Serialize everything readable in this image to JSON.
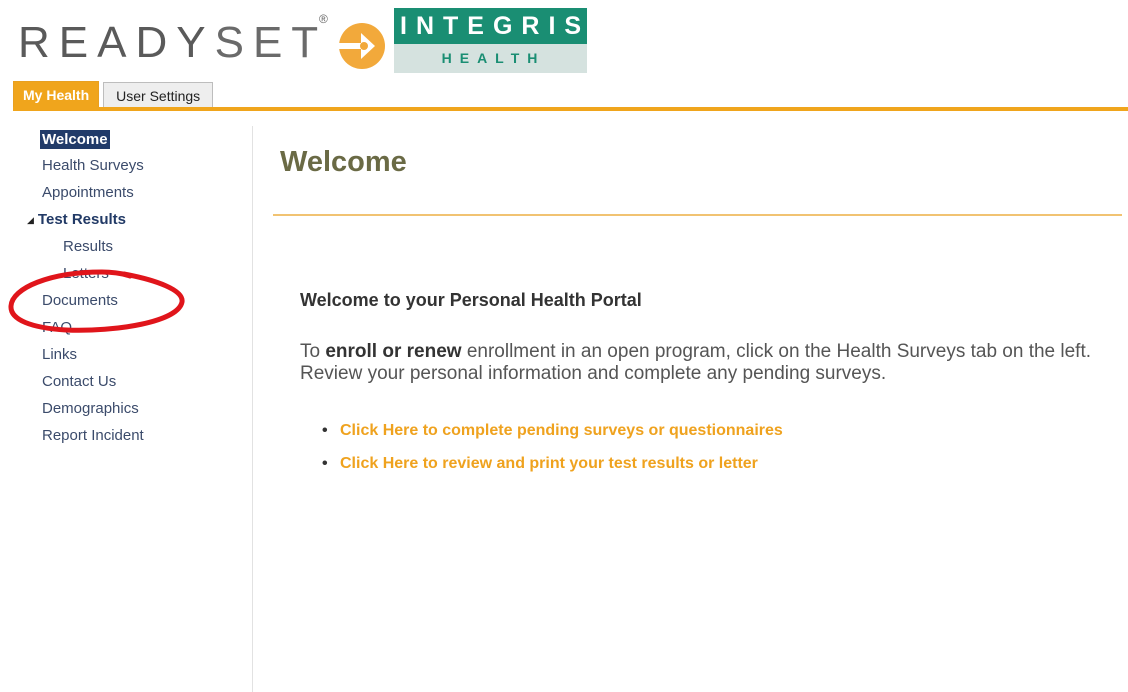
{
  "header": {
    "brand_ready": "READY",
    "brand_set": "SET",
    "brand_reg_mark": "®",
    "partner_top": "INTEGRIS",
    "partner_bottom": "HEALTH"
  },
  "tabs": [
    {
      "label": "My Health",
      "active": true
    },
    {
      "label": "User Settings",
      "active": false
    }
  ],
  "sidebar": {
    "items": [
      {
        "label": "Welcome",
        "active": true
      },
      {
        "label": "Health Surveys"
      },
      {
        "label": "Appointments"
      },
      {
        "label": "Test Results",
        "expanded": true
      },
      {
        "label": "Results"
      },
      {
        "label": "Letters"
      },
      {
        "label": "Documents"
      },
      {
        "label": "FAQ"
      },
      {
        "label": "Links"
      },
      {
        "label": "Contact Us"
      },
      {
        "label": "Demographics"
      },
      {
        "label": "Report Incident"
      }
    ]
  },
  "main": {
    "title": "Welcome",
    "heading": "Welcome to your Personal Health Portal",
    "intro_prefix": "To ",
    "intro_bold": "enroll or renew",
    "intro_suffix": " enrollment in an open program, click on the Health Surveys tab on the left. Review your personal information and complete any pending surveys.",
    "links": [
      "Click Here to complete pending surveys or questionnaires",
      "Click Here to review and print your test results or letter"
    ]
  },
  "colors": {
    "accent_orange": "#f0a51c",
    "nav_active_bg": "#213b69",
    "annotation_red": "#e0151b",
    "integris_green": "#1a8e73"
  }
}
